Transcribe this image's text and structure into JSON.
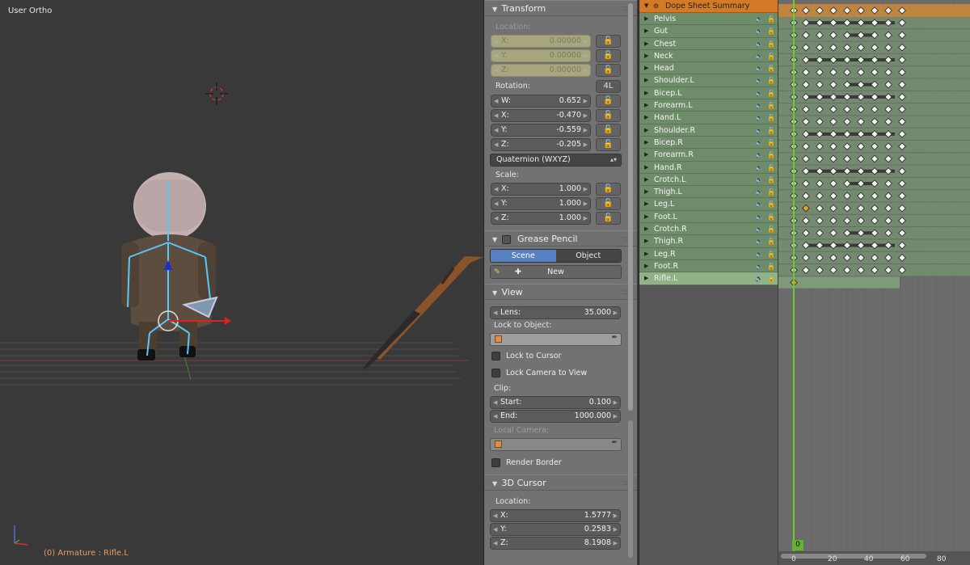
{
  "viewport": {
    "title": "User Ortho",
    "status": "(0) Armature : Rifle.L"
  },
  "transform": {
    "header": "Transform",
    "location_label": "Location:",
    "location": [
      {
        "axis": "X:",
        "value": "0.00000"
      },
      {
        "axis": "Y:",
        "value": "0.00000"
      },
      {
        "axis": "Z:",
        "value": "0.00000"
      }
    ],
    "rotation_label": "Rotation:",
    "rotation_mode_button": "4L",
    "rotation": [
      {
        "axis": "W:",
        "value": "0.652"
      },
      {
        "axis": "X:",
        "value": "-0.470"
      },
      {
        "axis": "Y:",
        "value": "-0.559"
      },
      {
        "axis": "Z:",
        "value": "-0.205"
      }
    ],
    "rotation_mode": "Quaternion (WXYZ)",
    "scale_label": "Scale:",
    "scale": [
      {
        "axis": "X:",
        "value": "1.000"
      },
      {
        "axis": "Y:",
        "value": "1.000"
      },
      {
        "axis": "Z:",
        "value": "1.000"
      }
    ]
  },
  "grease_pencil": {
    "header": "Grease Pencil",
    "scene_label": "Scene",
    "object_label": "Object",
    "new_label": "New"
  },
  "view": {
    "header": "View",
    "lens_label": "Lens:",
    "lens_value": "35.000",
    "lock_to_object_label": "Lock to Object:",
    "lock_to_cursor_label": "Lock to Cursor",
    "lock_camera_label": "Lock Camera to View",
    "clip_label": "Clip:",
    "clip_start_label": "Start:",
    "clip_start_value": "0.100",
    "clip_end_label": "End:",
    "clip_end_value": "1000.000",
    "local_camera_label": "Local Camera:",
    "render_border_label": "Render Border"
  },
  "cursor": {
    "header": "3D Cursor",
    "location_label": "Location:",
    "location": [
      {
        "axis": "X:",
        "value": "1.5777"
      },
      {
        "axis": "Y:",
        "value": "0.2583"
      },
      {
        "axis": "Z:",
        "value": "8.1908"
      }
    ]
  },
  "dopesheet": {
    "summary": "Dope Sheet Summary",
    "channels": [
      "Pelvis",
      "Gut",
      "Chest",
      "Neck",
      "Head",
      "Shoulder.L",
      "Bicep.L",
      "Forearm.L",
      "Hand.L",
      "Shoulder.R",
      "Bicep.R",
      "Forearm.R",
      "Hand.R",
      "Crotch.L",
      "Thigh.L",
      "Leg.L",
      "Foot.L",
      "Crotch.R",
      "Thigh.R",
      "Leg.R",
      "Foot.R",
      "Rifle.L"
    ],
    "selected_channel": "Rifle.L",
    "current_frame": "0",
    "ruler_labels": [
      "0",
      "20",
      "40",
      "60",
      "80"
    ]
  }
}
